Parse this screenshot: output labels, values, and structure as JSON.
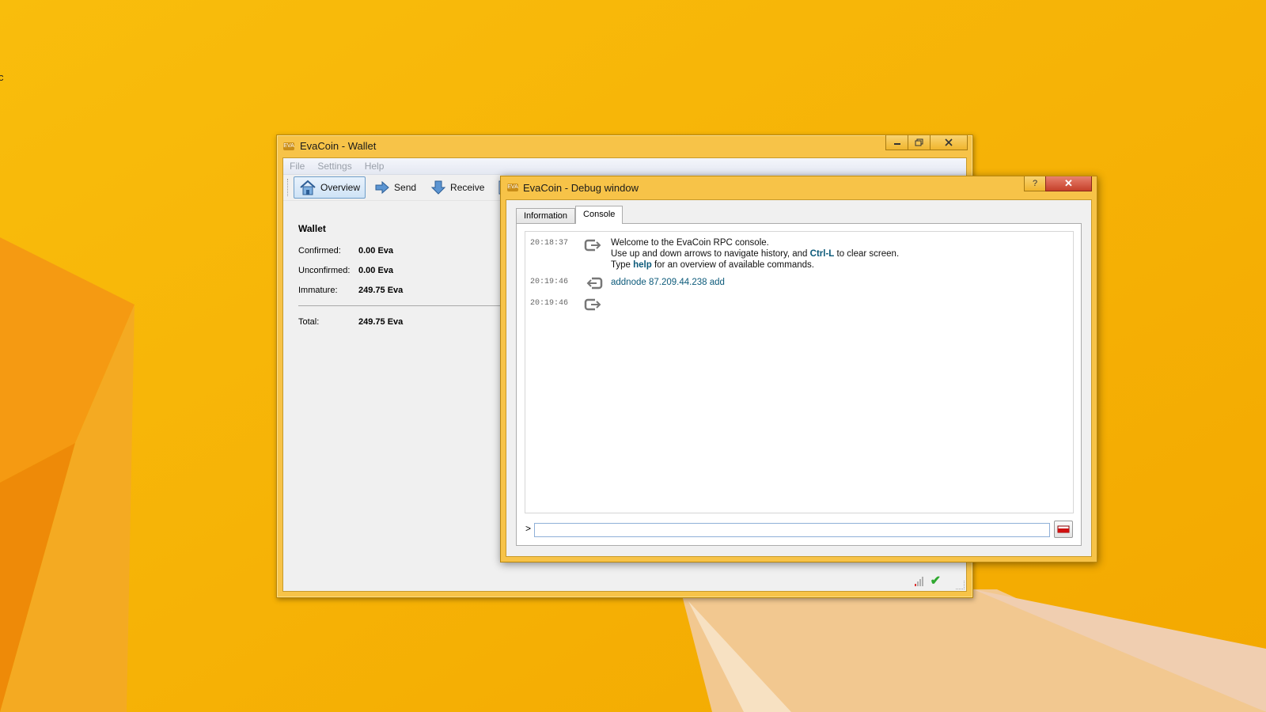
{
  "desktop": {
    "edge_char": "c"
  },
  "wallet_window": {
    "title": "EvaCoin - Wallet",
    "icon_text": "EVA",
    "menu": [
      "File",
      "Settings",
      "Help"
    ],
    "toolbar": {
      "overview": "Overview",
      "send": "Send",
      "receive": "Receive"
    },
    "overview": {
      "heading": "Wallet",
      "confirmed_label": "Confirmed:",
      "confirmed_value": "0.00 Eva",
      "unconfirmed_label": "Unconfirmed:",
      "unconfirmed_value": "0.00 Eva",
      "immature_label": "Immature:",
      "immature_value": "249.75 Eva",
      "total_label": "Total:",
      "total_value": "249.75 Eva"
    },
    "status_check": "✔"
  },
  "debug_window": {
    "title": "EvaCoin - Debug window",
    "icon_text": "EVA",
    "help_button": "?",
    "close_button": "✕",
    "tabs": {
      "information": "Information",
      "console": "Console"
    },
    "console": {
      "messages": [
        {
          "time": "20:18:37",
          "line1": "Welcome to the EvaCoin RPC console.",
          "line2_a": "Use up and down arrows to navigate history, and ",
          "line2_kw": "Ctrl-L",
          "line2_b": " to clear screen.",
          "line3_a": "Type ",
          "line3_kw": "help",
          "line3_b": " for an overview of available commands."
        },
        {
          "time": "20:19:46",
          "command": "addnode 87.209.44.238 add"
        },
        {
          "time": "20:19:46",
          "reply": ""
        }
      ],
      "prompt": ">",
      "input_value": ""
    }
  },
  "colors": {
    "desktop_bg": "#f6b400",
    "window_frame": "#f7c348",
    "command_text": "#0c5a7a",
    "close_red": "#c5402a"
  }
}
